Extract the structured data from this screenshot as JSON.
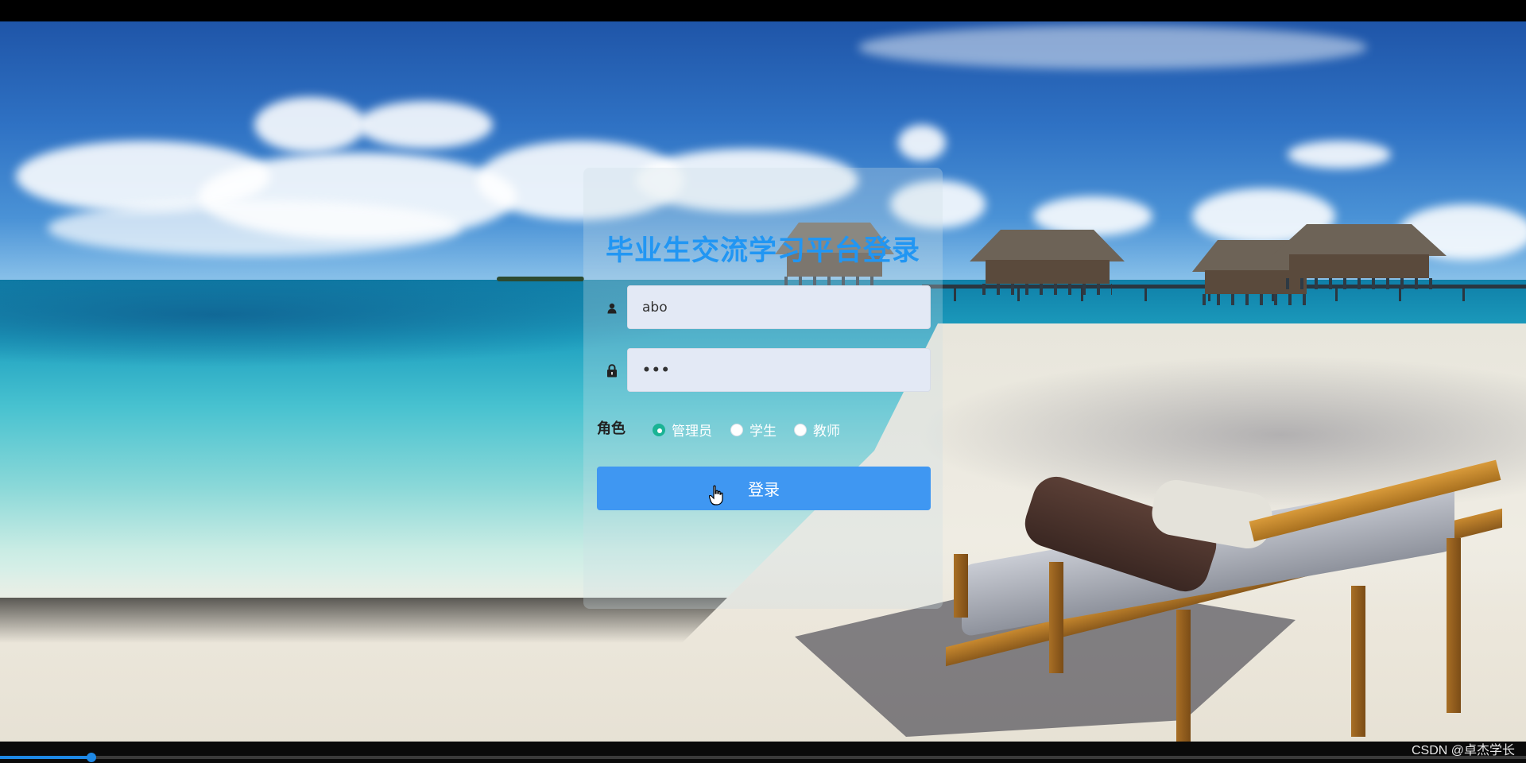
{
  "login": {
    "title": "毕业生交流学习平台登录",
    "username_value": "abo",
    "password_value": "•••",
    "role_label": "角色",
    "roles": [
      {
        "label": "管理员",
        "selected": true
      },
      {
        "label": "学生",
        "selected": false
      },
      {
        "label": "教师",
        "selected": false
      }
    ],
    "submit_label": "登录"
  },
  "icons": {
    "username": "user-icon",
    "password": "lock-icon"
  },
  "watermark": "CSDN @卓杰学长",
  "video": {
    "progress_fraction": 0.06
  },
  "colors": {
    "title": "#2196f3",
    "button": "#3f97f2",
    "radio_selected": "#1ab394",
    "input_bg": "#e3e9f5"
  }
}
